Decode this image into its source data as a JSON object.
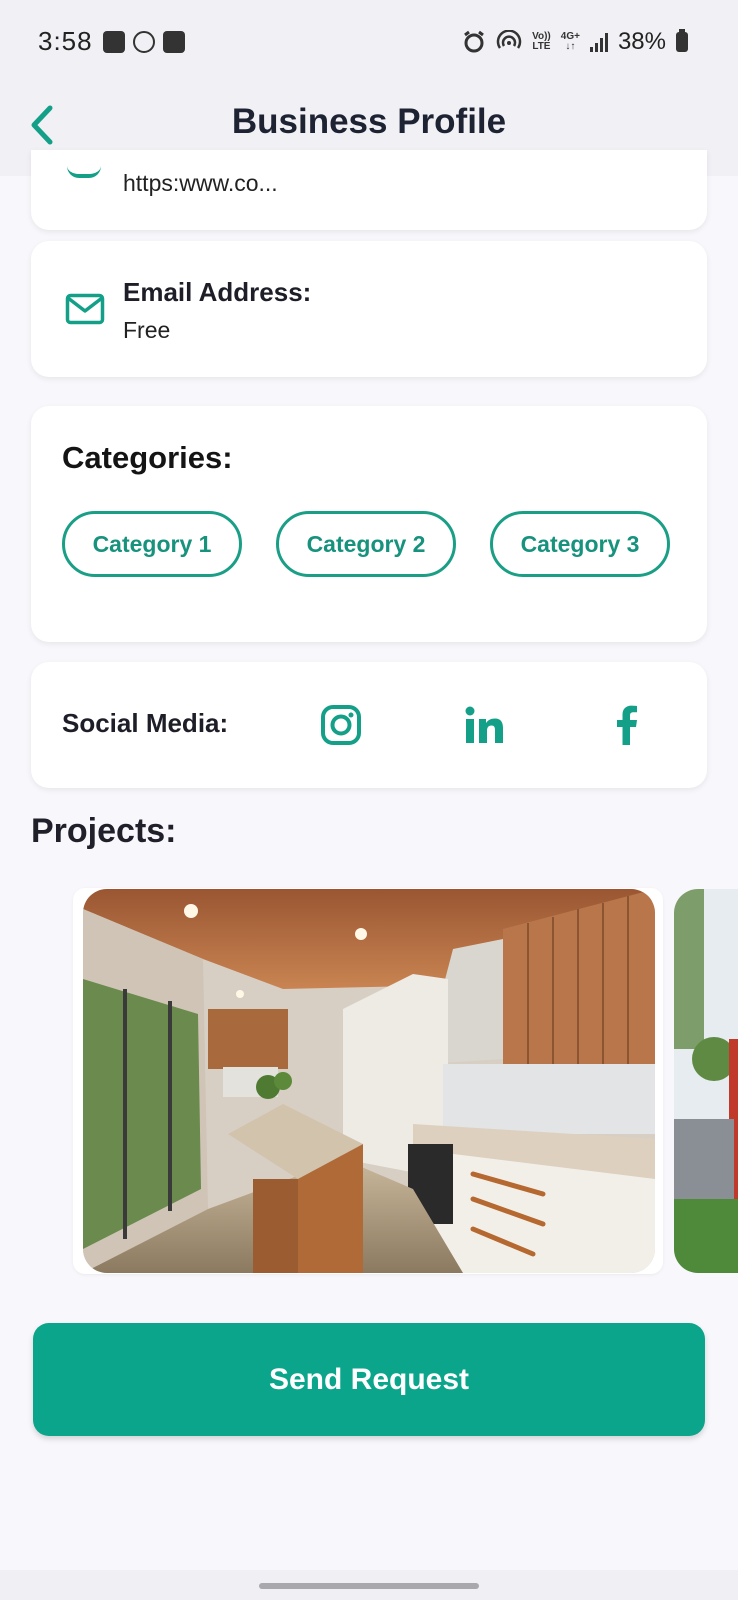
{
  "status_bar": {
    "time": "3:58",
    "network_top": "Vo))",
    "network_bottom": "LTE",
    "data_top": "4G+",
    "data_bottom": "↓↑",
    "battery": "38%"
  },
  "header": {
    "title": "Business Profile",
    "back_icon": "chevron-left-icon"
  },
  "website": {
    "value": "https:www.co...",
    "icon": "globe-icon"
  },
  "email": {
    "label": "Email Address:",
    "value": "Free",
    "icon": "mail-icon"
  },
  "categories": {
    "title": "Categories:",
    "items": [
      "Category 1",
      "Category 2",
      "Category 3"
    ]
  },
  "social": {
    "label": "Social Media:",
    "icons": [
      "instagram-icon",
      "linkedin-icon",
      "facebook-icon"
    ]
  },
  "projects": {
    "title": "Projects:"
  },
  "actions": {
    "send_request": "Send Request"
  },
  "colors": {
    "accent": "#0aa58a",
    "chip_border": "#1a9e86",
    "background": "#f8f7fb"
  }
}
